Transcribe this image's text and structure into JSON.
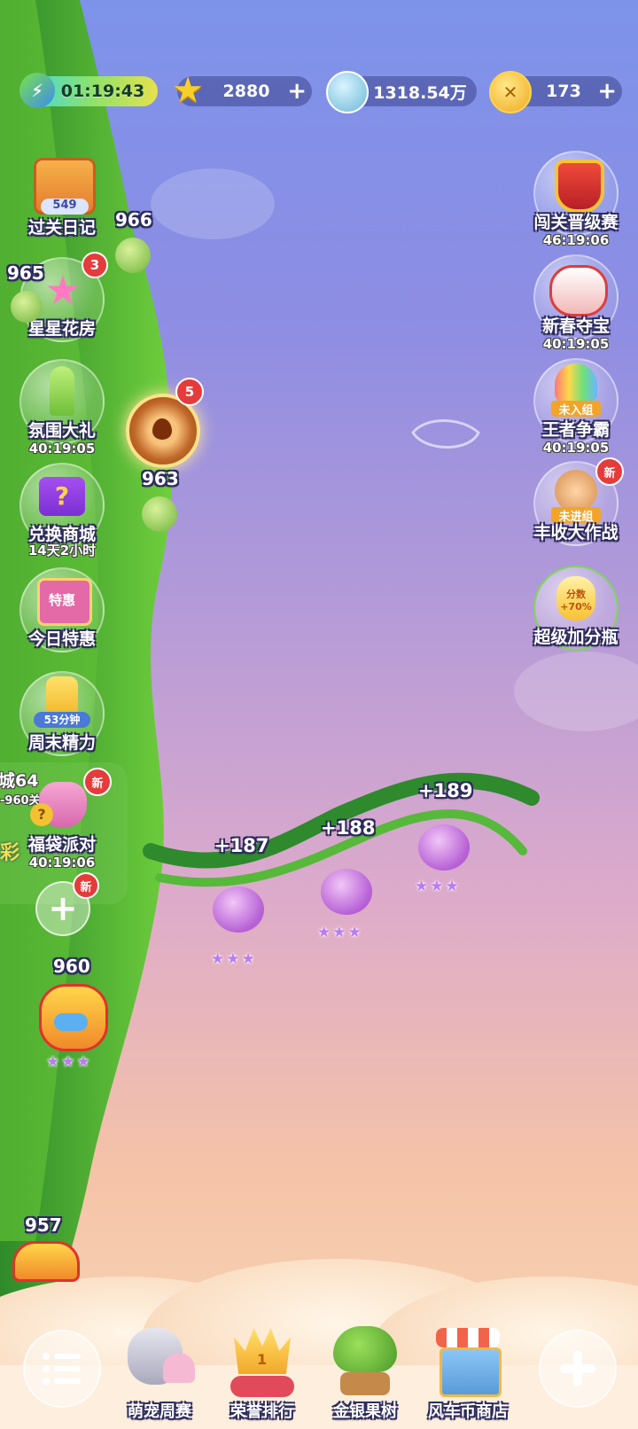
{
  "top_bar": {
    "timer": "01:19:43",
    "stars": "2880",
    "diamonds": "1318.54万",
    "coins": "173",
    "plus": "+"
  },
  "left_buttons": [
    {
      "label": "过关日记",
      "sub": "549"
    },
    {
      "label": "星星花房",
      "badge": "3"
    },
    {
      "label": "氛围大礼",
      "time": "40:19:05"
    },
    {
      "label": "兑换商城",
      "time": "14天2小时"
    },
    {
      "label": "今日特惠",
      "tag": "特惠"
    },
    {
      "label": "周末精力",
      "tag": "53分钟"
    },
    {
      "label": "福袋派对",
      "time": "40:19:06",
      "badge": "新"
    }
  ],
  "left_partial": {
    "line1": "城64",
    "line2": "-960关",
    "line3": "彩"
  },
  "left_add": {
    "badge": "新",
    "symbol": "+"
  },
  "right_buttons": [
    {
      "label": "闯关晋级赛",
      "time": "46:19:06"
    },
    {
      "label": "新春夺宝",
      "time": "40:19:05"
    },
    {
      "label": "王者争霸",
      "time": "40:19:05",
      "tag": "未入组"
    },
    {
      "label": "丰收大作战",
      "tag": "未进组",
      "badge": "新"
    },
    {
      "label": "超级加分瓶",
      "tag": "分数 +70%"
    }
  ],
  "wheel_badge": "5",
  "levels": [
    {
      "num": "966"
    },
    {
      "num": "965"
    },
    {
      "num": "963"
    },
    {
      "num": "960",
      "stars": "★★★"
    },
    {
      "num": "957"
    }
  ],
  "rewards": [
    {
      "label": "+187",
      "stars": "★★★"
    },
    {
      "label": "+188",
      "stars": "★★★"
    },
    {
      "label": "+189",
      "stars": "★★★"
    }
  ],
  "dock": [
    {
      "label": "萌宠周赛"
    },
    {
      "label": "荣誉排行",
      "trophy": "1"
    },
    {
      "label": "金银果树"
    },
    {
      "label": "风车币商店"
    }
  ],
  "colors": {
    "vine": "#3f9b2e",
    "badge": "#e53b3b",
    "accent": "#f2c232"
  }
}
